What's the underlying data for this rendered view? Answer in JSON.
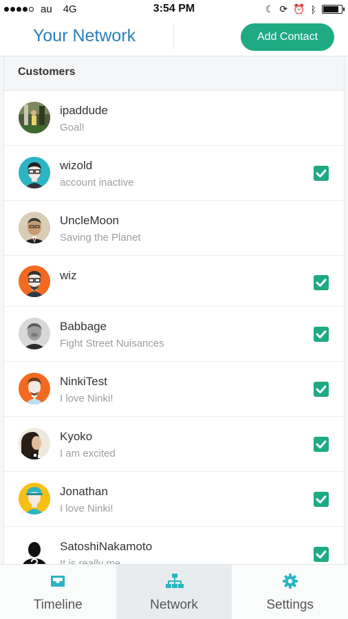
{
  "status_bar": {
    "carrier": "au",
    "network": "4G",
    "time": "3:54 PM"
  },
  "header": {
    "title": "Your Network",
    "add_contact_label": "Add Contact"
  },
  "section": {
    "title": "Customers"
  },
  "contacts": [
    {
      "name": "ipaddude",
      "status": "Goal!",
      "checked": false
    },
    {
      "name": "wizold",
      "status": "account inactive",
      "checked": true
    },
    {
      "name": "UncleMoon",
      "status": "Saving the Planet",
      "checked": false
    },
    {
      "name": "wiz",
      "status": "",
      "checked": true
    },
    {
      "name": "Babbage",
      "status": "Fight Street Nuisances",
      "checked": true
    },
    {
      "name": "NinkiTest",
      "status": "I love Ninki!",
      "checked": true
    },
    {
      "name": "Kyoko",
      "status": "I am excited",
      "checked": true
    },
    {
      "name": "Jonathan",
      "status": "I love Ninki!",
      "checked": true
    },
    {
      "name": "SatoshiNakamoto",
      "status": "It is really me",
      "checked": true
    }
  ],
  "tabs": [
    {
      "label": "Timeline",
      "icon": "inbox-icon",
      "active": false
    },
    {
      "label": "Network",
      "icon": "network-icon",
      "active": true
    },
    {
      "label": "Settings",
      "icon": "gear-icon",
      "active": false
    }
  ],
  "colors": {
    "accent": "#1faa84",
    "title_blue": "#2a7fb8",
    "icon_teal": "#2bb5c4"
  }
}
